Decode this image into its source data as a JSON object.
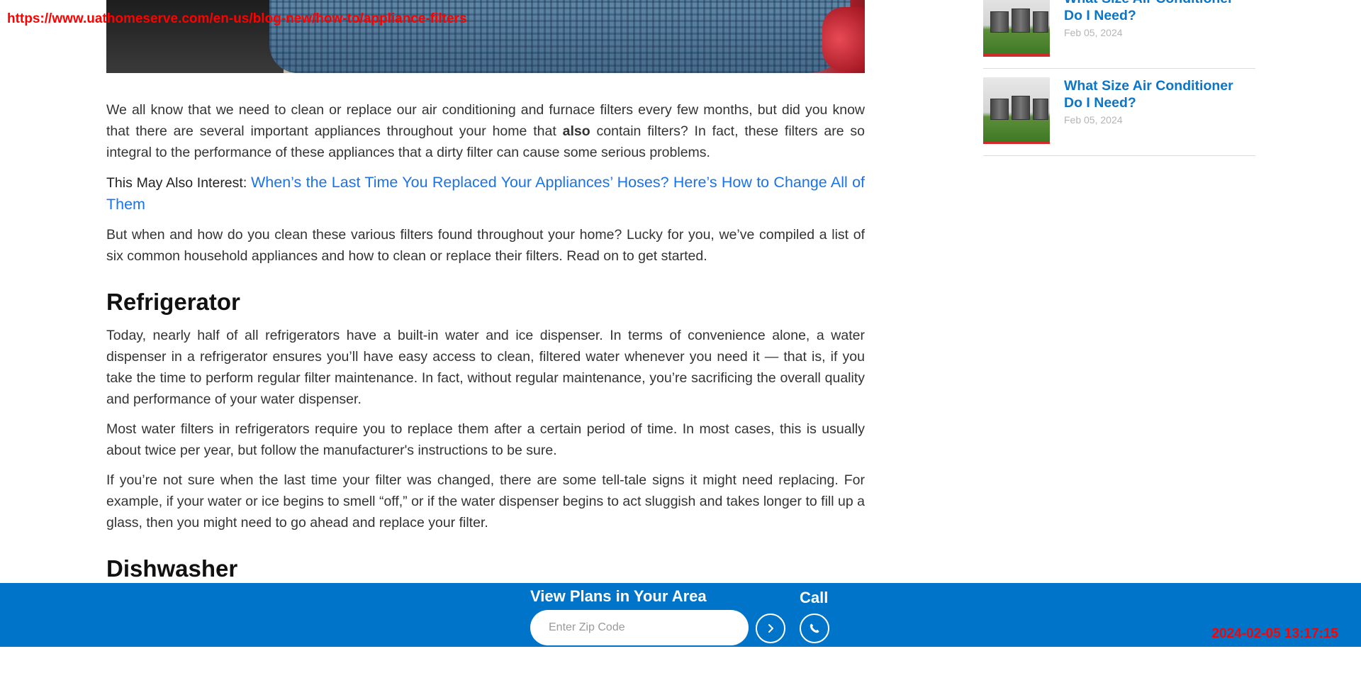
{
  "browser": {
    "url": "https://www.uathomeserve.com/en-us/blog-new/how-to/appliance-filters",
    "timestamp": "2024-02-05 13:17:15"
  },
  "article": {
    "intro_before_bold": "We all know that we need to clean or replace our air conditioning and furnace filters every few months, but did you know that there are several important appliances throughout your home that ",
    "intro_bold": "also",
    "intro_after_bold": " contain filters? In fact, these filters are so integral to the performance of these appliances that a dirty filter can cause some serious problems.",
    "also_interest_label": "This May Also Interest: ",
    "also_interest_link": "When’s the Last Time You Replaced Your Appliances’ Hoses? Here’s How to Change All of Them",
    "paragraph_2": "But when and how do you clean these various filters found throughout your home? Lucky for you, we’ve compiled a list of six common household appliances and how to clean or replace their filters. Read on to get started.",
    "section_1_heading": "Refrigerator",
    "section_1_p1": "Today, nearly half of all refrigerators have a built-in water and ice dispenser. In terms of convenience alone, a water dispenser in a refrigerator ensures you’ll have easy access to clean, filtered water whenever you need it — that is, if you take the time to perform regular filter maintenance. In fact, without regular maintenance, you’re sacrificing the overall quality and performance of your water dispenser.",
    "section_1_p2": "Most water filters in refrigerators require you to replace them after a certain period of time. In most cases, this is usually about twice per year, but follow the manufacturer's instructions to be sure.",
    "section_1_p3": "If you’re not sure when the last time your filter was changed, there are some tell-tale signs it might need replacing. For example, if your water or ice begins to smell “off,” or if the water dispenser begins to act sluggish and takes longer to fill up a glass, then you might need to go ahead and replace your filter.",
    "section_2_heading": "Dishwasher"
  },
  "sidebar": {
    "items": [
      {
        "title": "What Size Air Conditioner Do I Need?",
        "date": "Feb 05, 2024"
      },
      {
        "title": "What Size Air Conditioner Do I Need?",
        "date": "Feb 05, 2024"
      }
    ]
  },
  "cta": {
    "title": "View Plans in Your Area",
    "zip_placeholder": "Enter Zip Code",
    "call_label": "Call"
  },
  "colors": {
    "cta_background": "#0074c8",
    "link_blue": "#1a73e8",
    "sidebar_title": "#0a75c9",
    "overlay_red": "#ff0000"
  },
  "icons": {
    "go": "chevron-right-icon",
    "call": "phone-icon"
  }
}
